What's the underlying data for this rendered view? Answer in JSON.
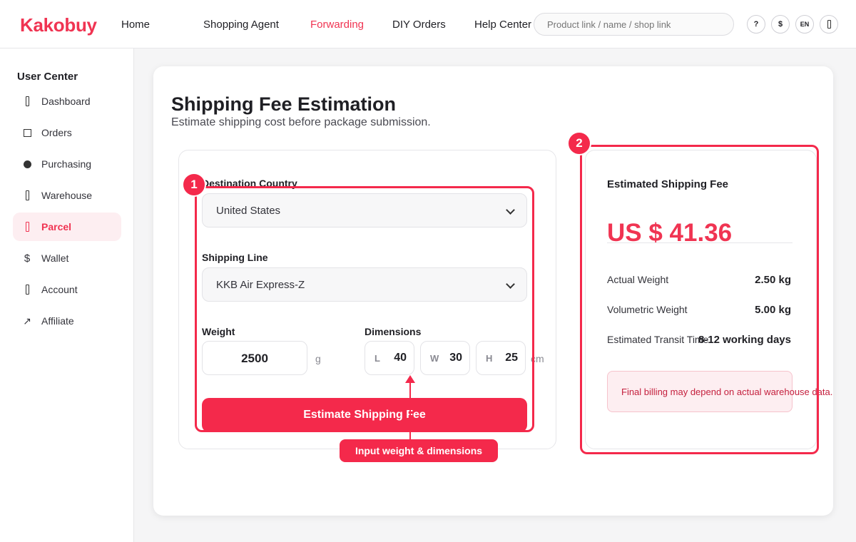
{
  "header": {
    "logo": "Kakobuy",
    "nav": [
      "Home",
      "Shopping Agent",
      "Forwarding",
      "DIY Orders",
      "Help Center"
    ],
    "active_nav": "Forwarding",
    "search_placeholder": "Product link / name / shop link",
    "icon_buttons": [
      "?",
      "$",
      "EN"
    ]
  },
  "sidebar": {
    "title": "User Center",
    "items": [
      {
        "label": "Dashboard",
        "icon": "bar-icon"
      },
      {
        "label": "Orders",
        "icon": "square-icon"
      },
      {
        "label": "Purchasing",
        "icon": "dot-icon"
      },
      {
        "label": "Warehouse",
        "icon": "bar-icon"
      },
      {
        "label": "Parcel",
        "icon": "bar-icon"
      },
      {
        "label": "Wallet",
        "icon": "dollar-icon"
      },
      {
        "label": "Account",
        "icon": "bar-icon"
      },
      {
        "label": "Affiliate",
        "icon": "arrow-up-right-icon"
      }
    ],
    "active_item": "Parcel"
  },
  "page": {
    "title": "Shipping Fee Estimation",
    "subtitle": "Estimate shipping cost before package submission."
  },
  "form": {
    "destination_label": "Destination Country",
    "destination_value": "United States",
    "shipping_line_label": "Shipping Line",
    "shipping_line_value": "KKB Air Express-Z",
    "weight_label": "Weight",
    "weight_value": "2500",
    "weight_unit": "g",
    "dimensions_label": "Dimensions",
    "dim_l_label": "L",
    "dim_l_value": "40",
    "dim_w_label": "W",
    "dim_w_value": "30",
    "dim_h_label": "H",
    "dim_h_value": "25",
    "dim_unit": "cm",
    "button_label": "Estimate Shipping Fee"
  },
  "result": {
    "title": "Estimated Shipping Fee",
    "amount": "US $ 41.36",
    "actual_weight_label": "Actual Weight",
    "actual_weight_value": "2.50 kg",
    "volumetric_weight_label": "Volumetric Weight",
    "volumetric_weight_value": "5.00 kg",
    "transit_label": "Estimated Transit Time",
    "transit_value": "8-12 working days",
    "note": "Final billing may depend on actual warehouse data."
  },
  "annotations": {
    "badge_1": "1",
    "badge_2": "2",
    "callout": "Input weight & dimensions"
  },
  "colors": {
    "accent": "#f03452",
    "button": "#f4294b"
  }
}
